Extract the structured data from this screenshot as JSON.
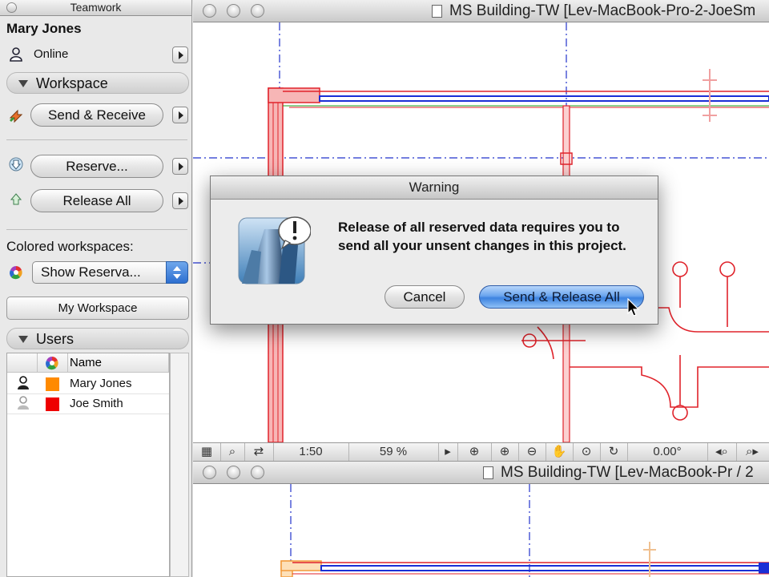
{
  "teamwork": {
    "title": "Teamwork",
    "user_name": "Mary Jones",
    "status": "Online",
    "workspace_header": "Workspace",
    "send_receive": "Send & Receive",
    "reserve": "Reserve...",
    "release_all": "Release All",
    "colored_workspaces_label": "Colored workspaces:",
    "colored_select_value": "Show Reserva...",
    "my_workspace": "My Workspace",
    "users_header": "Users",
    "users_table": {
      "name_column": "Name",
      "rows": [
        {
          "name": "Mary Jones",
          "color": "#ff8a00"
        },
        {
          "name": "Joe Smith",
          "color": "#ee0000"
        }
      ]
    }
  },
  "window_top": {
    "title": "MS Building-TW  [Lev-MacBook-Pro-2-JoeSm"
  },
  "window_bottom": {
    "title": "MS Building-TW  [Lev-MacBook-Pr / 2"
  },
  "statusbar": {
    "scale": "1:50",
    "zoom": "59 %",
    "angle": "0.00°"
  },
  "dialog": {
    "title": "Warning",
    "message": "Release of all reserved data requires you to send all your unsent changes in this project.",
    "cancel": "Cancel",
    "confirm": "Send & Release All"
  },
  "colors": {
    "plan_red": "#e0232b",
    "plan_blue": "#1a2fd6",
    "axis_blue": "#2233cc",
    "accent_blue": "#3d83e0"
  }
}
